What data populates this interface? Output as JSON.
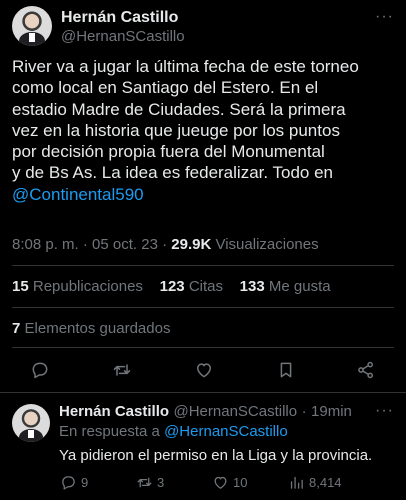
{
  "tweet": {
    "author_name": "Hernán Castillo",
    "author_handle": "@HernanSCastillo",
    "text_lines": [
      "River va a jugar la última fecha de este torneo",
      "como local en Santiago del Estero. En el",
      "estadio Madre de Ciudades. Será la primera",
      "vez en la historia que jueuge por los puntos",
      "por decisión propia fuera del Monumental",
      "y de Bs As. La idea es federalizar.  Todo en"
    ],
    "mention": "@Continental590",
    "time": "8:08 p. m.",
    "separator": "·",
    "date": "05 oct. 23",
    "separator2": "·",
    "views_count": "29.9K",
    "views_label": "Visualizaciones"
  },
  "stats": {
    "retweets_count": "15",
    "retweets_label": "Republicaciones",
    "quotes_count": "123",
    "quotes_label": "Citas",
    "likes_count": "133",
    "likes_label": "Me gusta",
    "bookmarks_count": "7",
    "bookmarks_label": "Elementos guardados"
  },
  "actions": {
    "icons": [
      "reply-icon",
      "retweet-icon",
      "like-icon",
      "bookmark-icon",
      "share-icon"
    ]
  },
  "reply": {
    "author_name": "Hernán Castillo",
    "author_handle": "@HernanSCastillo",
    "separator": "·",
    "time_ago": "19min",
    "replying_to_prefix": "En respuesta a",
    "replying_to_handle": "@HernanSCastillo",
    "text": "Ya pidieron el permiso en la Liga y la provincia.",
    "reply_count": "9",
    "retweet_count": "3",
    "like_count": "10",
    "views_count": "8,414"
  },
  "colors": {
    "background": "#000000",
    "text": "#e7e9ea",
    "muted": "#71767b",
    "link": "#1d9bf0",
    "divider": "#2f3336"
  }
}
